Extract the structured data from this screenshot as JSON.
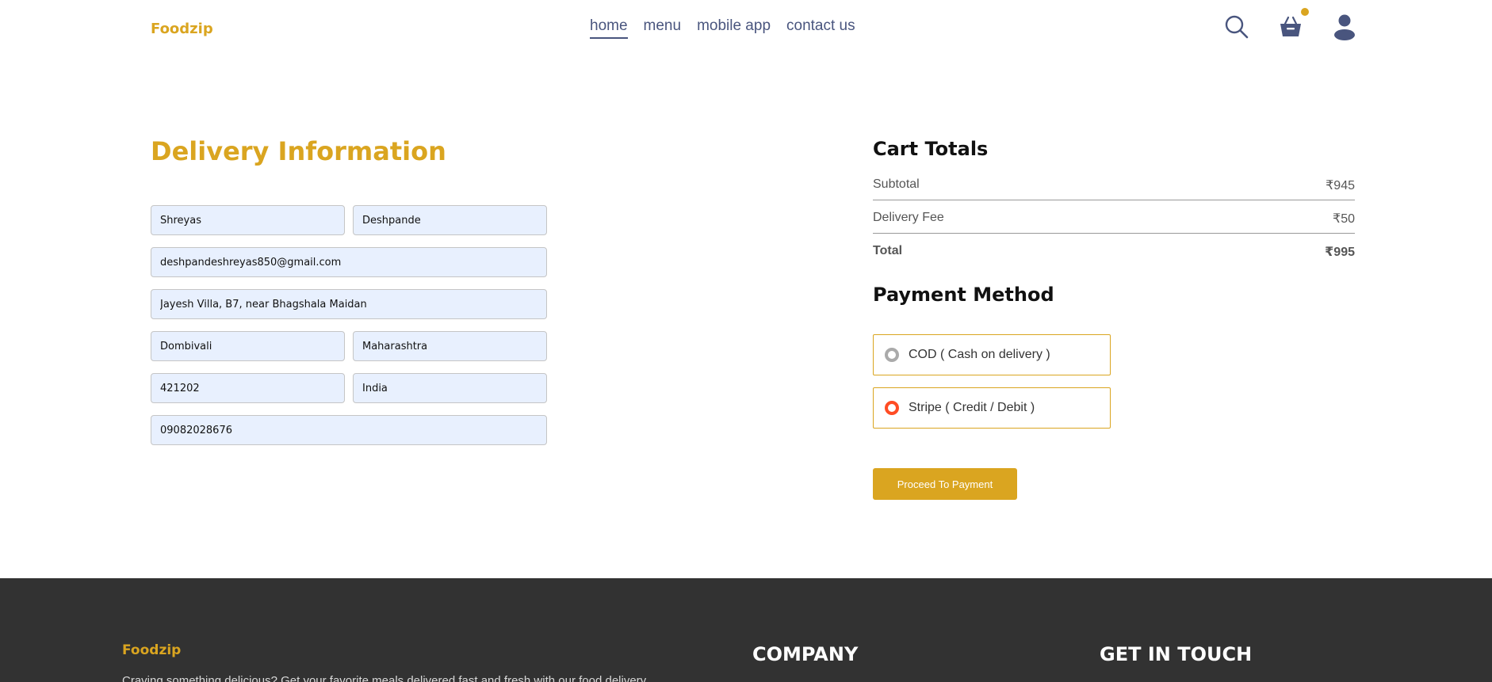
{
  "navbar": {
    "logo": "Foodzip",
    "menu": [
      "home",
      "menu",
      "mobile app",
      "contact us"
    ],
    "active": "home",
    "icons": [
      "search-icon",
      "basket-icon",
      "profile-icon"
    ]
  },
  "delivery": {
    "title": "Delivery Information",
    "fields": {
      "first_name": "Shreyas",
      "last_name": "Deshpande",
      "email": "deshpandeshreyas850@gmail.com",
      "street": "Jayesh Villa, B7, near Bhagshala Maidan",
      "city": "Dombivali",
      "state": "Maharashtra",
      "zip": "421202",
      "country": "India",
      "phone": "09082028676"
    }
  },
  "cart_totals": {
    "title": "Cart Totals",
    "subtotal_label": "Subtotal",
    "subtotal_value": "₹945",
    "delivery_label": "Delivery Fee",
    "delivery_value": "₹50",
    "total_label": "Total",
    "total_value": "₹995"
  },
  "payment": {
    "title": "Payment Method",
    "options": [
      {
        "label": "COD ( Cash on delivery )",
        "selected": false
      },
      {
        "label": "Stripe ( Credit / Debit )",
        "selected": true
      }
    ],
    "button": "Proceed To Payment"
  },
  "footer": {
    "logo": "Foodzip",
    "text": "Craving something delicious? Get your favorite meals delivered fast and fresh with our food delivery",
    "company_heading": "COMPANY",
    "contact_heading": "GET IN TOUCH"
  },
  "colors": {
    "accent": "#daa520",
    "text": "#49557e",
    "field_bg": "#e8f0fe",
    "selected_radio": "#ff4c24",
    "footer_bg": "#323232"
  }
}
